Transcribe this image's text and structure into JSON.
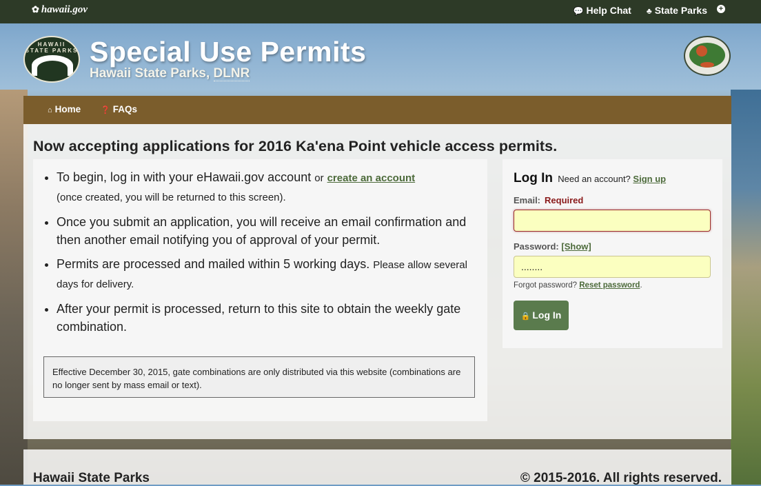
{
  "topbar": {
    "brand": "hawaii.gov",
    "links": [
      {
        "label": "Help Chat",
        "icon": "chat-icon"
      },
      {
        "label": "State Parks",
        "icon": "tree-icon"
      }
    ],
    "plus_icon": "plus-circle-icon"
  },
  "header": {
    "title": "Special Use Permits",
    "subtitle_prefix": "Hawaii State Parks, ",
    "subtitle_abbr": "DLNR",
    "left_logo_text": "HAWAII STATE PARKS"
  },
  "nav": {
    "items": [
      {
        "label": "Home",
        "icon": "home-icon"
      },
      {
        "label": "FAQs",
        "icon": "question-icon"
      }
    ]
  },
  "main": {
    "headline": "Now accepting applications for 2016 Ka'ena Point vehicle access permits.",
    "bullets": {
      "b1_text": "To begin, log in with your eHawaii.gov account",
      "b1_or": "or",
      "b1_link": "create an account",
      "b1_note": "(once created, you will be returned to this screen).",
      "b2_text": "Once you submit an application, you will receive an email confirmation and then another email notifying you of approval of your permit.",
      "b3_text": "Permits are processed and mailed within 5 working days.",
      "b3_note": "Please allow several days for delivery.",
      "b4_text": "After your permit is processed, return to this site to obtain the weekly gate combination."
    },
    "notice": "Effective December 30, 2015, gate combinations are only distributed via this website (combinations are no longer sent by mass email or text)."
  },
  "login": {
    "title": "Log In",
    "need_account": "Need an account?",
    "signup": "Sign up",
    "email_label": "Email:",
    "email_required": "Required",
    "email_value": "",
    "password_label": "Password:",
    "password_show": "[Show]",
    "password_value": "........",
    "forgot": "Forgot password?",
    "reset": "Reset password",
    "button": "Log In"
  },
  "footer": {
    "left": "Hawaii State Parks",
    "right": "© 2015-2016. All rights reserved."
  }
}
